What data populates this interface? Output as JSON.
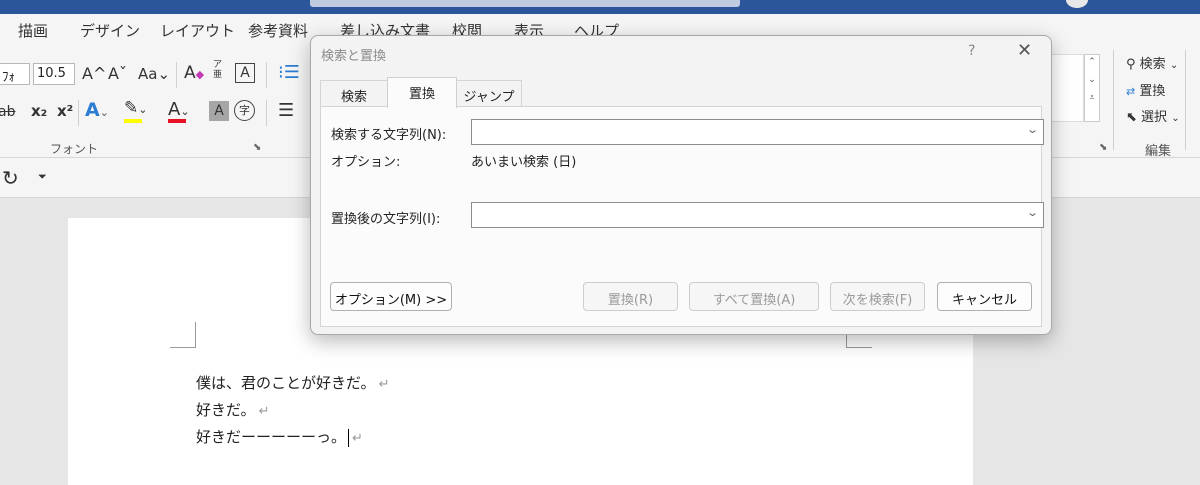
{
  "menu": {
    "tabs": [
      "描画",
      "デザイン",
      "レイアウト",
      "参考資料",
      "差し込み文書",
      "校閲",
      "表示",
      "ヘルプ"
    ]
  },
  "ribbon": {
    "font_name": "ﾌｫ",
    "font_size": "10.5",
    "font_group_label": "フォント",
    "edit_group_label": "編集",
    "grow_font": "A^",
    "shrink_font": "Aˇ",
    "change_case": "Aa",
    "strikethrough": "ab",
    "subscript": "x₂",
    "superscript": "x²",
    "font_color_letter": "A",
    "char_shading_letter": "A",
    "enclosed_char": "字",
    "char_border_letter": "A",
    "phonetic_top": "ア",
    "phonetic_bottom": "亜",
    "find_label": "検索",
    "replace_label": "置換",
    "select_label": "選択"
  },
  "document": {
    "lines": [
      "僕は、君のことが好きだ。",
      "好きだ。",
      "好きだーーーーーっ。"
    ],
    "para_mark": "↵"
  },
  "dialog": {
    "title": "検索と置換",
    "help": "?",
    "close": "✕",
    "tabs": [
      "検索",
      "置換",
      "ジャンプ"
    ],
    "active_tab": "置換",
    "find_label": "検索する文字列(N):",
    "find_value": "",
    "options_label": "オプション:",
    "options_value": "あいまい検索 (日)",
    "replace_label": "置換後の文字列(I):",
    "replace_value": "",
    "buttons": {
      "options": "オプション(M) >>",
      "replace": "置換(R)",
      "replace_all": "すべて置換(A)",
      "find_next": "次を検索(F)",
      "cancel": "キャンセル"
    }
  },
  "colors": {
    "title_bar": "#2b579a",
    "highlight": "#ffff00",
    "font_color": "#e81123",
    "text_effect": "#2b7cd3"
  }
}
